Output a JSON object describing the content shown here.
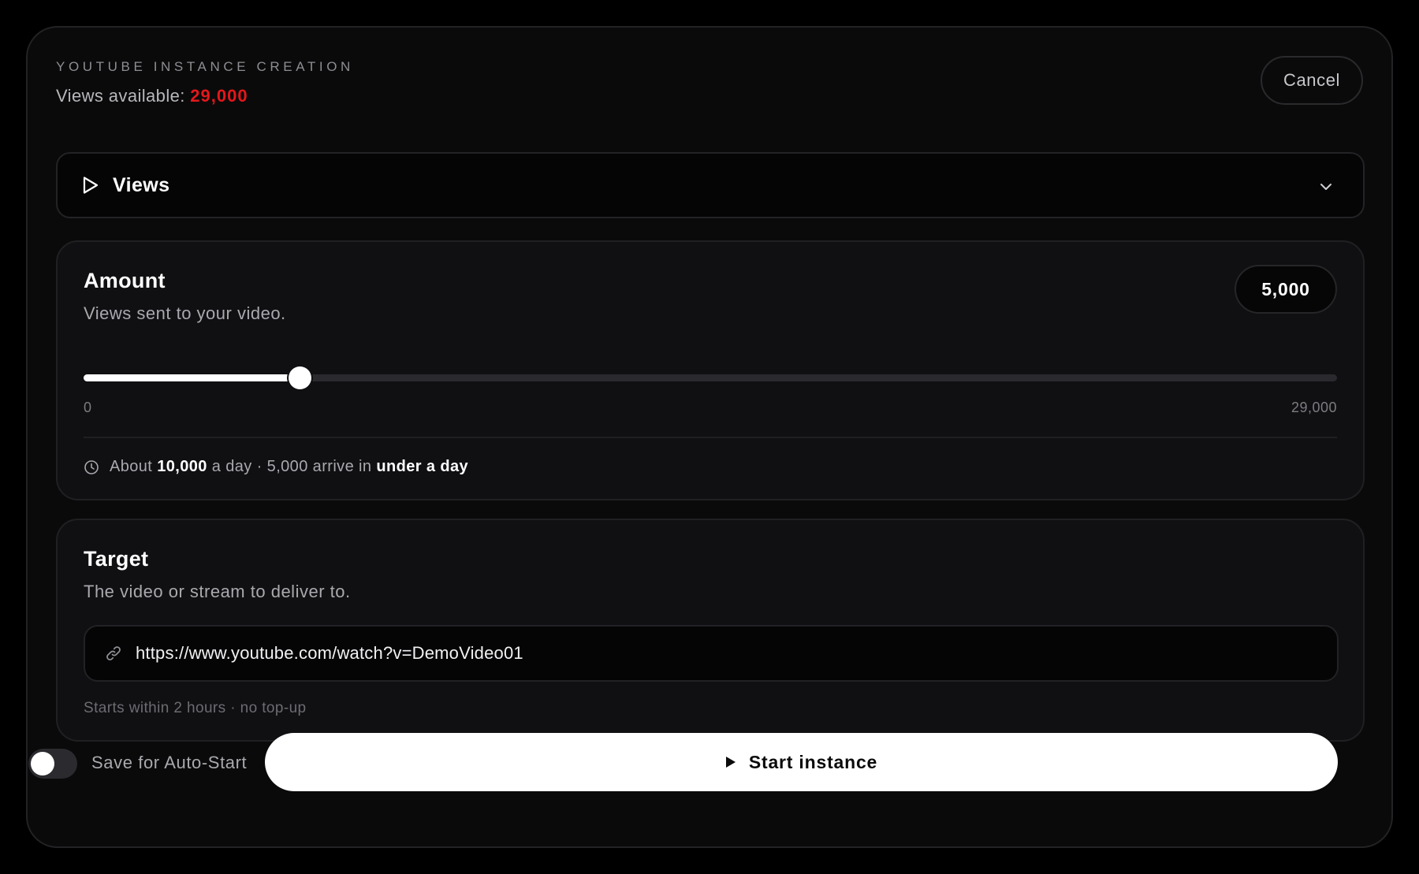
{
  "header": {
    "eyebrow": "YOUTUBE INSTANCE CREATION",
    "available_label": "Views available:",
    "available_value": "29,000",
    "available_color": "#e5171a",
    "cancel_label": "Cancel"
  },
  "service_select": {
    "icon": "play-outline-icon",
    "selected": "Views",
    "chevron_icon": "chevron-down-icon"
  },
  "amount": {
    "title": "Amount",
    "subtitle": "Views sent to your video.",
    "value_display": "5,000",
    "slider": {
      "min": 0,
      "max": 29000,
      "value": 5000
    },
    "min_label": "0",
    "max_label": "29,000",
    "eta": {
      "icon": "clock-icon",
      "prefix": "About",
      "rate": "10,000",
      "mid": "a day · 5,000 arrive in",
      "duration": "under a day"
    }
  },
  "target": {
    "title": "Target",
    "subtitle": "The video or stream to deliver to.",
    "link_icon": "link-icon",
    "url": "https://www.youtube.com/watch?v=DemoVideo01",
    "hint": "Starts within 2 hours · no top-up"
  },
  "footer": {
    "auto_start_label": "Save for Auto-Start",
    "auto_start_on": false,
    "start_icon": "play-solid-icon",
    "start_label": "Start instance"
  }
}
